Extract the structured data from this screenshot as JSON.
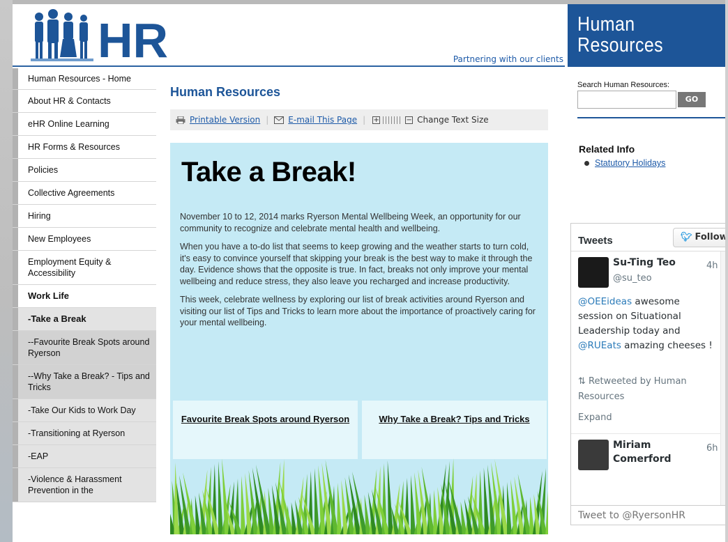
{
  "header": {
    "logo_text": "HR",
    "tagline": "Partnering with our clients",
    "section_title_line1": "Human",
    "section_title_line2": "Resources"
  },
  "leftnav": {
    "items": [
      {
        "label": "Human Resources - Home",
        "style": "h1"
      },
      {
        "label": "About HR & Contacts",
        "style": ""
      },
      {
        "label": "eHR Online Learning",
        "style": ""
      },
      {
        "label": "HR Forms & Resources",
        "style": ""
      },
      {
        "label": "Policies",
        "style": ""
      },
      {
        "label": "Collective Agreements",
        "style": ""
      },
      {
        "label": "Hiring",
        "style": ""
      },
      {
        "label": "New Employees",
        "style": ""
      },
      {
        "label": "Employment Equity & Accessibility",
        "style": ""
      },
      {
        "label": "Work Life",
        "style": "bold"
      },
      {
        "label": "-Take a Break",
        "style": "sub bold"
      },
      {
        "label": "--Favourite Break Spots around Ryerson",
        "style": "sub2"
      },
      {
        "label": "--Why Take a Break? - Tips and Tricks",
        "style": "sub2"
      },
      {
        "label": "-Take Our Kids to Work Day",
        "style": "sub"
      },
      {
        "label": "-Transitioning at Ryerson",
        "style": "sub"
      },
      {
        "label": "-EAP",
        "style": "sub"
      },
      {
        "label": "-Violence & Harassment Prevention in the",
        "style": "sub"
      }
    ]
  },
  "content": {
    "page_title": "Human Resources",
    "toolbar": {
      "printable": "Printable Version",
      "email": "E-mail This Page",
      "plus": "+",
      "minus": "−",
      "text_size": "Change Text Size"
    },
    "article": {
      "heading": "Take a Break!",
      "paragraphs": [
        "November 10 to 12, 2014 marks Ryerson Mental Wellbeing Week, an opportunity for our community to recognize and celebrate mental health and wellbeing.",
        "When you have a to-do list that seems to keep growing and the weather starts to turn cold, it's easy to convince yourself that skipping your break is the best way to make it through the day. Evidence shows that the opposite is true. In fact, breaks not only improve your mental wellbeing and reduce stress, they also leave you recharged and increase productivity.",
        "This week, celebrate wellness by exploring our list of break activities around Ryerson and visiting our list of Tips and Tricks to learn more about the importance of proactively caring for your mental wellbeing."
      ],
      "card_left": "Favourite Break Spots around Ryerson",
      "card_right": "Why Take a Break? Tips and Tricks"
    }
  },
  "right": {
    "search_label": "Search Human Resources:",
    "search_value": "",
    "search_button": "GO",
    "related_title": "Related Info",
    "related_link": "Statutory Holidays",
    "tweets": {
      "title": "Tweets",
      "follow": "Follow",
      "tweet1": {
        "name": "Su-Ting Teo",
        "handle": "@su_teo",
        "time": "4h",
        "mention1": "@OEEideas",
        "text1": " awesome session on Situational Leadership today and ",
        "mention2": "@RUEats",
        "text2": " amazing cheeses !",
        "retweeted": "Retweeted by Human Resources",
        "expand": "Expand"
      },
      "tweet2": {
        "name": "Miriam Comerford",
        "time": "6h"
      },
      "compose_placeholder": "Tweet to @RyersonHR"
    }
  },
  "colors": {
    "brand_blue": "#1d5598",
    "article_bg": "#c5eaf5"
  }
}
